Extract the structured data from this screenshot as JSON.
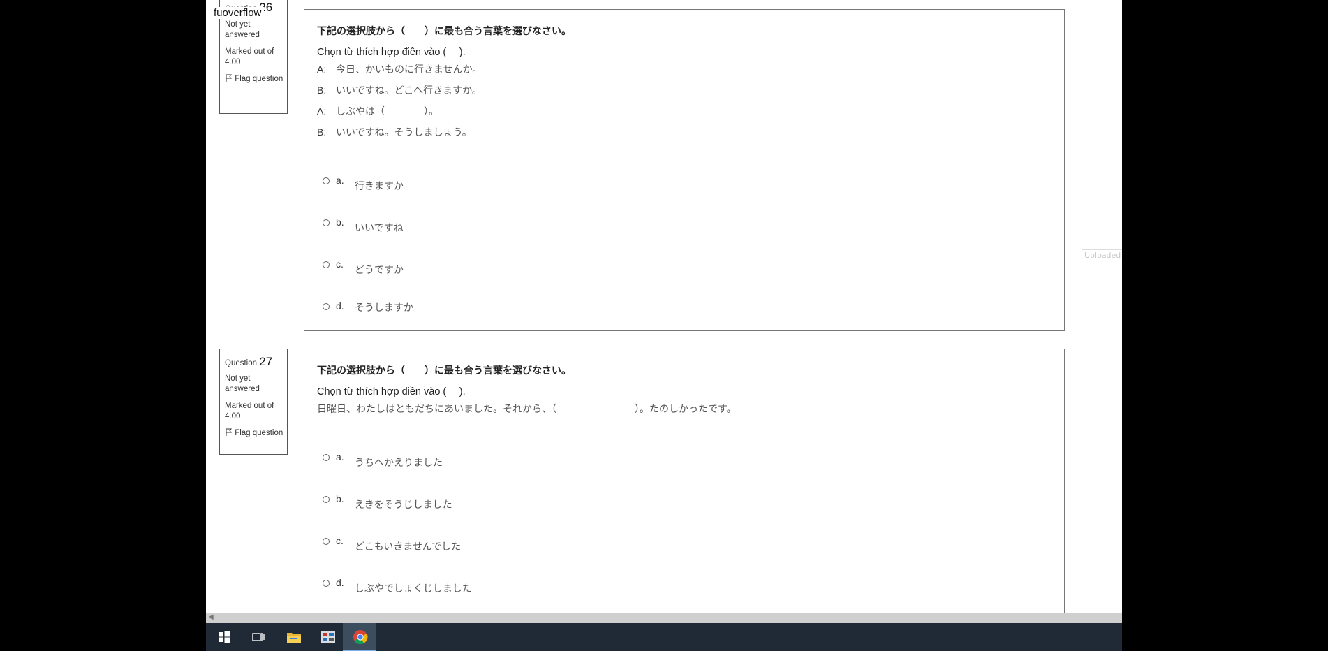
{
  "watermark": "fuoverflow",
  "uploaded_label": "Uploaded",
  "questions": [
    {
      "label": "Question",
      "number": "26",
      "state": "Not yet answered",
      "grade": "Marked out of 4.00",
      "flag": "Flag question",
      "instruction": "下記の選択肢から（　　）に最も合う言葉を選びなさい。",
      "instruction_vn": "Chọn từ thích hợp điền vào (　 ).",
      "dialog": [
        {
          "speaker": "A:",
          "text": "今日、かいものに行きませんか。"
        },
        {
          "speaker": "B:",
          "text": "いいですね。どこへ行きますか。"
        },
        {
          "speaker": "A:",
          "text": "しぶやは（　　　　）。"
        },
        {
          "speaker": "B:",
          "text": "いいですね。そうしましょう。"
        }
      ],
      "options": [
        {
          "letter": "a.",
          "text": "行きますか"
        },
        {
          "letter": "b.",
          "text": "いいですね"
        },
        {
          "letter": "c.",
          "text": "どうですか"
        },
        {
          "letter": "d.",
          "text": "そうしますか"
        }
      ]
    },
    {
      "label": "Question",
      "number": "27",
      "state": "Not yet answered",
      "grade": "Marked out of 4.00",
      "flag": "Flag question",
      "instruction": "下記の選択肢から（　　）に最も合う言葉を選びなさい。",
      "instruction_vn": "Chọn từ thích hợp điền vào (　 ).",
      "sentence": "日曜日、わたしはともだちにあいました。それから、（　　　　　　　　）。たのしかったです。",
      "options": [
        {
          "letter": "a.",
          "text": "うちへかえりました"
        },
        {
          "letter": "b.",
          "text": "えきをそうじしました"
        },
        {
          "letter": "c.",
          "text": "どこもいきませんでした"
        },
        {
          "letter": "d.",
          "text": "しぶやでしょくじしました"
        }
      ]
    }
  ],
  "taskbar": {
    "items": [
      {
        "icon": "windows-start-icon",
        "active": false
      },
      {
        "icon": "task-view-icon",
        "active": false
      },
      {
        "icon": "file-explorer-icon",
        "active": false
      },
      {
        "icon": "app-grid-icon",
        "active": false
      },
      {
        "icon": "chrome-icon",
        "active": true
      }
    ]
  }
}
